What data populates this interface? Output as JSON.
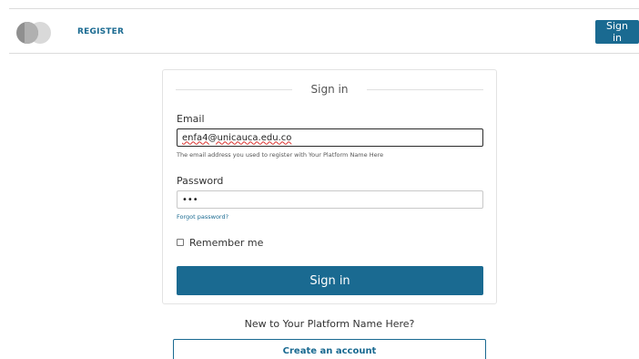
{
  "header": {
    "logo_icon": "two-circles-logo",
    "register_label": "REGISTER",
    "signin_label": "Sign in"
  },
  "form": {
    "title": "Sign in",
    "email_label": "Email",
    "email_value": "enfa4@unicauca.edu.co",
    "email_helper": "The email address you used to register with Your Platform Name Here",
    "password_label": "Password",
    "password_value": "•••",
    "forgot_label": "Forgot password?",
    "remember_label": "Remember me",
    "submit_label": "Sign in"
  },
  "footer": {
    "new_to_text": "New to Your Platform Name Here?",
    "create_label": "Create an account"
  },
  "colors": {
    "accent": "#1a6a91",
    "border": "#dcdcdc"
  }
}
